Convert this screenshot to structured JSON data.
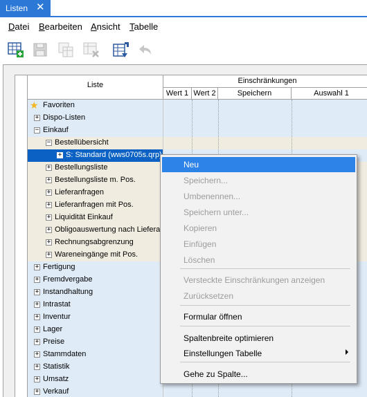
{
  "tab": {
    "title": "Listen",
    "close": "✕"
  },
  "menu": [
    {
      "label": "Datei",
      "key": "D",
      "rest": "atei"
    },
    {
      "label": "Bearbeiten",
      "key": "B",
      "rest": "earbeiten"
    },
    {
      "label": "Ansicht",
      "key": "A",
      "rest": "nsicht"
    },
    {
      "label": "Tabelle",
      "key": "T",
      "rest": "abelle"
    }
  ],
  "toolbar": {
    "icons": [
      "new-grid-icon",
      "save-disk-icon",
      "copy-grid-icon",
      "delete-grid-icon",
      "import-grid-icon",
      "undo-icon"
    ]
  },
  "grid": {
    "header_list": "Liste",
    "header_group": "Einschränkungen",
    "columns": [
      "Wert 1",
      "Wert 2",
      "Speichern",
      "Auswahl 1"
    ]
  },
  "rows": [
    {
      "label": "Favoriten",
      "icon": "star-icon",
      "depth": 0,
      "style": "blue"
    },
    {
      "label": "Dispo-Listen",
      "expander": "+",
      "depth": 0,
      "style": "blue"
    },
    {
      "label": "Einkauf",
      "expander": "−",
      "depth": 0,
      "style": "blue"
    },
    {
      "label": "Bestellübersicht",
      "expander": "−",
      "depth": 1,
      "style": "beige"
    },
    {
      "label": "S: Standard (wws0705s.qrp)",
      "expander": "+",
      "depth": 2,
      "style": "sel"
    },
    {
      "label": "Bestellungsliste",
      "expander": "+",
      "depth": 1,
      "style": "beige"
    },
    {
      "label": "Bestellungsliste m. Pos.",
      "expander": "+",
      "depth": 1,
      "style": "beige"
    },
    {
      "label": "Lieferanfragen",
      "expander": "+",
      "depth": 1,
      "style": "beige"
    },
    {
      "label": "Lieferanfragen mit Pos.",
      "expander": "+",
      "depth": 1,
      "style": "beige"
    },
    {
      "label": "Liquidität Einkauf",
      "expander": "+",
      "depth": 1,
      "style": "beige"
    },
    {
      "label": "Obligoauswertung nach Lieferant",
      "expander": "+",
      "depth": 1,
      "style": "beige"
    },
    {
      "label": "Rechnungsabgrenzung",
      "expander": "+",
      "depth": 1,
      "style": "beige"
    },
    {
      "label": "Wareneingänge mit Pos.",
      "expander": "+",
      "depth": 1,
      "style": "beige"
    },
    {
      "label": "Fertigung",
      "expander": "+",
      "depth": 0,
      "style": "blue"
    },
    {
      "label": "Fremdvergabe",
      "expander": "+",
      "depth": 0,
      "style": "blue"
    },
    {
      "label": "Instandhaltung",
      "expander": "+",
      "depth": 0,
      "style": "blue"
    },
    {
      "label": "Intrastat",
      "expander": "+",
      "depth": 0,
      "style": "blue"
    },
    {
      "label": "Inventur",
      "expander": "+",
      "depth": 0,
      "style": "blue"
    },
    {
      "label": "Lager",
      "expander": "+",
      "depth": 0,
      "style": "blue"
    },
    {
      "label": "Preise",
      "expander": "+",
      "depth": 0,
      "style": "blue"
    },
    {
      "label": "Stammdaten",
      "expander": "+",
      "depth": 0,
      "style": "blue"
    },
    {
      "label": "Statistik",
      "expander": "+",
      "depth": 0,
      "style": "blue"
    },
    {
      "label": "Umsatz",
      "expander": "+",
      "depth": 0,
      "style": "blue"
    },
    {
      "label": "Verkauf",
      "expander": "+",
      "depth": 0,
      "style": "blue"
    }
  ],
  "context_menu": {
    "items": [
      {
        "label": "Neu",
        "state": "highlighted"
      },
      {
        "label": "Speichern...",
        "state": "disabled"
      },
      {
        "label": "Umbenennen...",
        "state": "disabled"
      },
      {
        "label": "Speichern unter...",
        "state": "disabled"
      },
      {
        "label": "Kopieren",
        "state": "disabled"
      },
      {
        "label": "Einfügen",
        "state": "disabled"
      },
      {
        "label": "Löschen",
        "state": "disabled"
      },
      {
        "label": "Versteckte Einschränkungen anzeigen",
        "state": "disabled"
      },
      {
        "label": "Zurücksetzen",
        "state": "disabled"
      },
      {
        "label": "Formular öffnen",
        "state": "enabled"
      },
      {
        "label": "Spaltenbreite optimieren",
        "state": "enabled"
      },
      {
        "label": "Einstellungen Tabelle",
        "state": "enabled",
        "submenu": true
      },
      {
        "label": "Gehe zu Spalte...",
        "state": "enabled"
      }
    ]
  },
  "colors": {
    "accent": "#2b78d6",
    "row_blue": "#dfebf7",
    "row_beige": "#f1ece0",
    "selection": "#0b62c4",
    "menu_highlight": "#2e83e8",
    "disabled_text": "#9c9c9c"
  }
}
